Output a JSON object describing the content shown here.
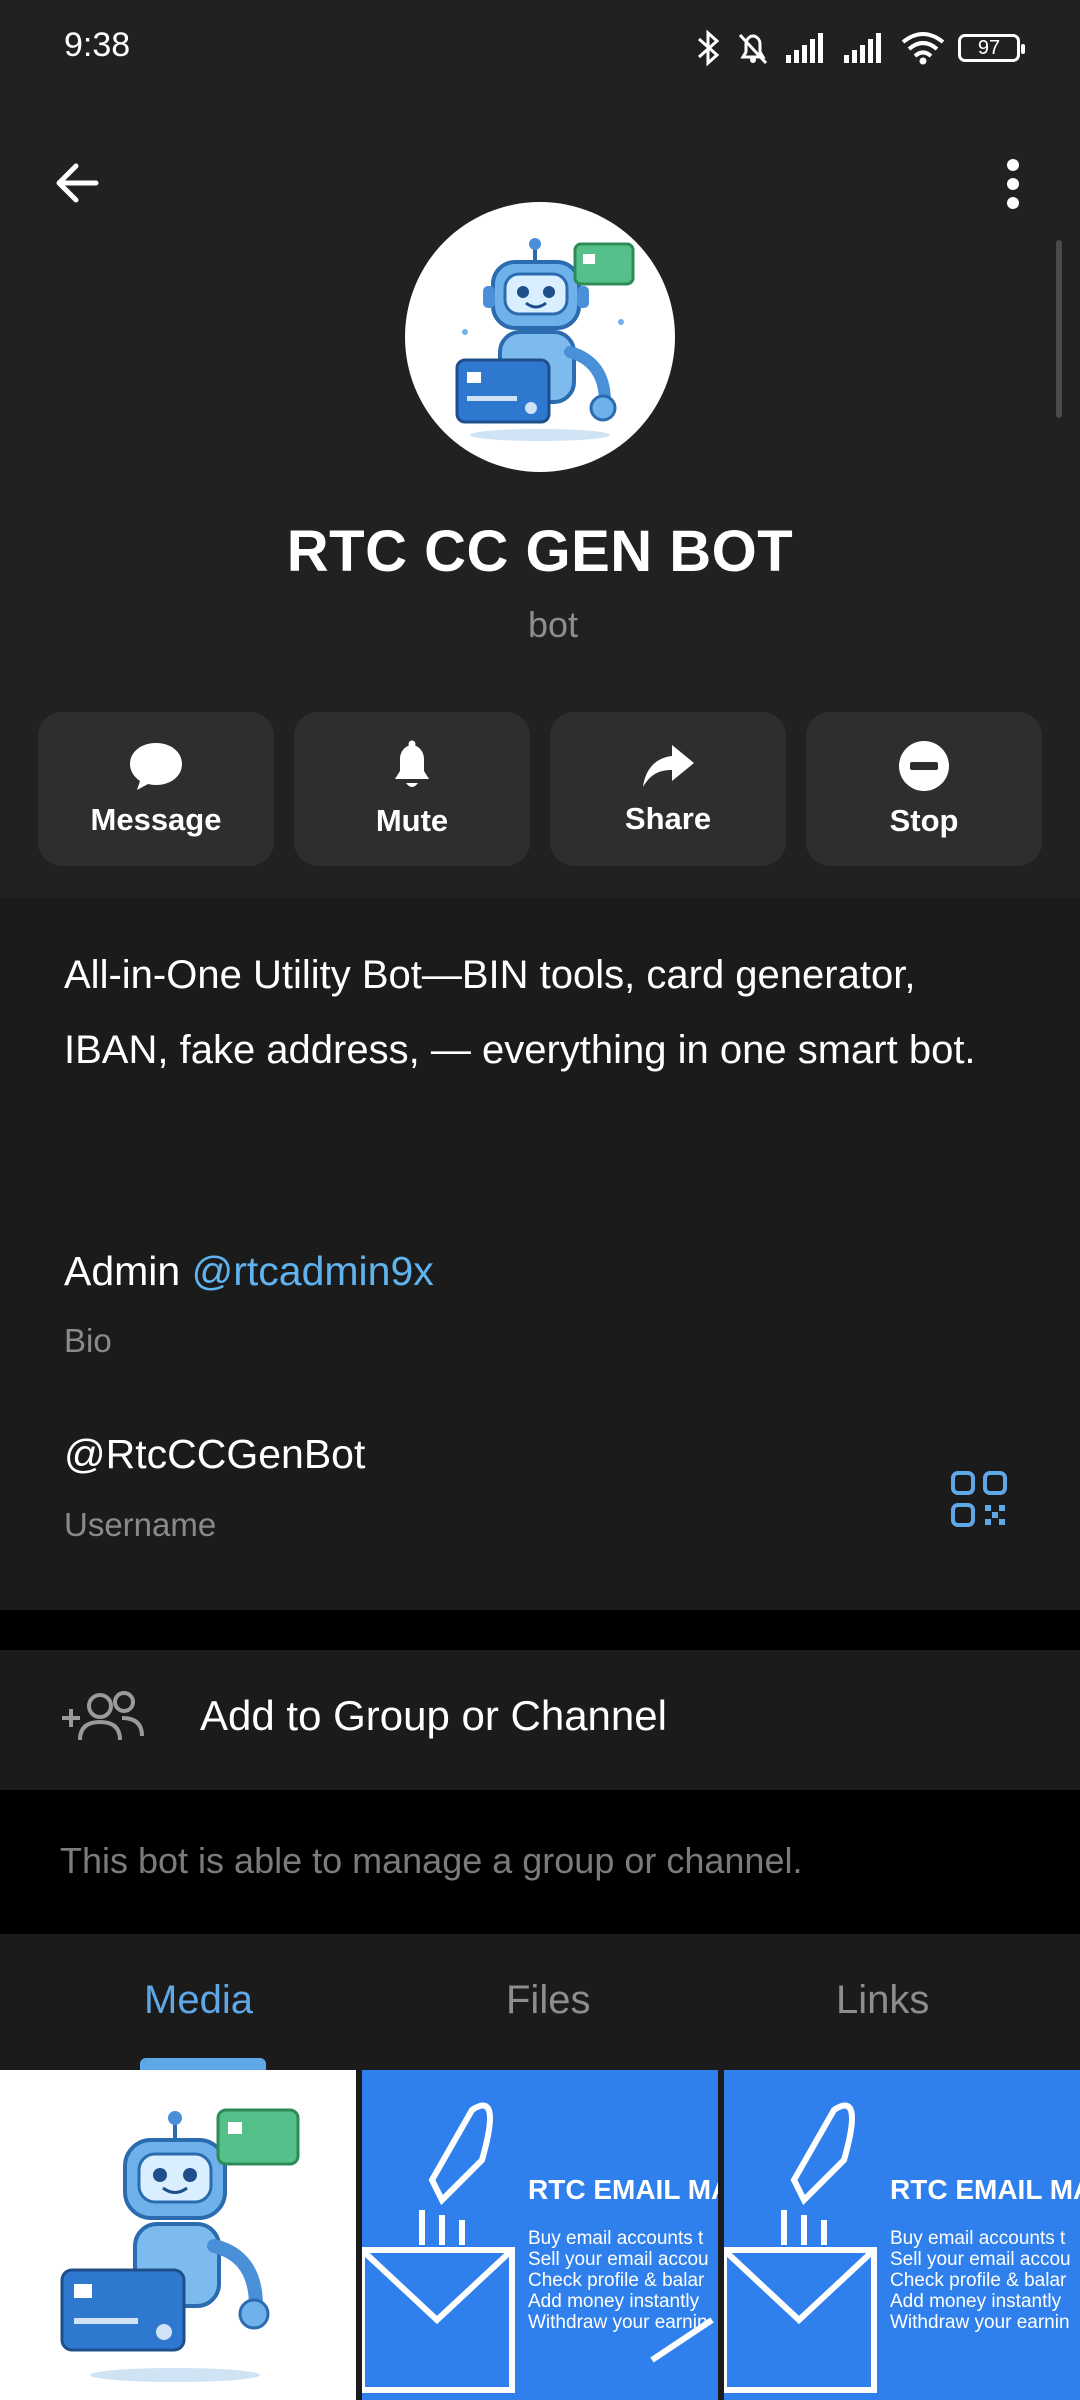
{
  "status": {
    "time": "9:38",
    "battery": "97"
  },
  "profile": {
    "name": "RTC CC GEN BOT",
    "type": "bot"
  },
  "actions": [
    {
      "label": "Message",
      "icon": "message-icon"
    },
    {
      "label": "Mute",
      "icon": "bell-icon"
    },
    {
      "label": "Share",
      "icon": "share-icon"
    },
    {
      "label": "Stop",
      "icon": "stop-icon"
    }
  ],
  "info": {
    "description": "All-in-One Utility Bot—BIN tools, card generator, IBAN, fake address, — everything in one smart bot.",
    "admin_prefix": "Admin ",
    "admin_link": "@rtcadmin9x",
    "bio_label": "Bio",
    "username": "@RtcCCGenBot",
    "username_label": "Username"
  },
  "add_group": {
    "label": "Add to Group or Channel",
    "hint": "This bot is able to manage a group or channel."
  },
  "tabs": [
    {
      "label": "Media",
      "active": true
    },
    {
      "label": "Files",
      "active": false
    },
    {
      "label": "Links",
      "active": false
    }
  ],
  "media": {
    "promo_heading": "RTC EMAIL MARK",
    "promo_lines": [
      "Buy email accounts t",
      "Sell your email accou",
      "Check profile & balar",
      "Add money instantly",
      "Withdraw your earnin"
    ]
  },
  "colors": {
    "accent": "#5fa8e8",
    "link": "#5fb3ef",
    "background": "#212121"
  }
}
